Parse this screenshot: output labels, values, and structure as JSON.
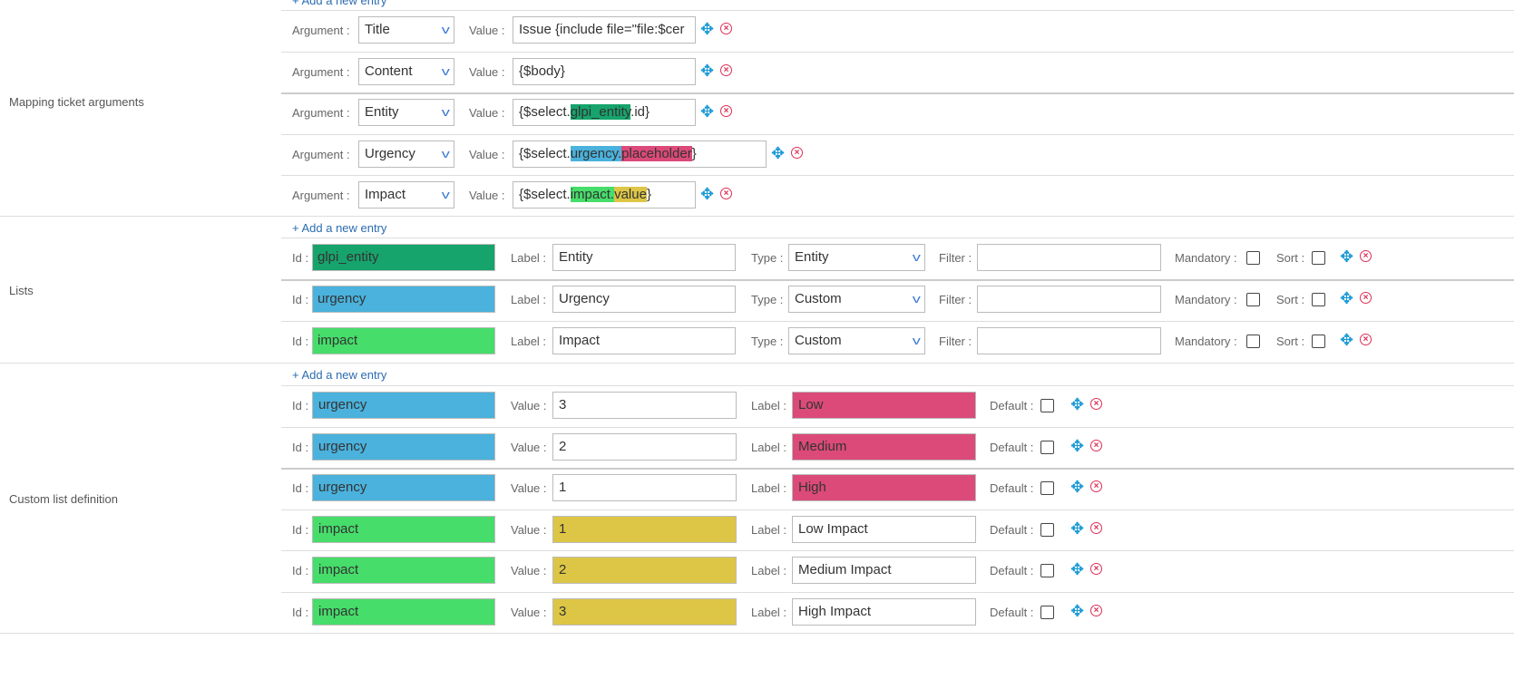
{
  "colors": {
    "dark_green": "#16a46c",
    "blue": "#4ab2dc",
    "pink": "#dc4a7a",
    "green": "#46dd6a",
    "yellow": "#ddc646"
  },
  "labels": {
    "argument": "Argument :",
    "value": "Value :",
    "id": "Id :",
    "label": "Label :",
    "type": "Type :",
    "filter": "Filter :",
    "mandatory": "Mandatory :",
    "sort": "Sort :",
    "default": "Default :",
    "add_entry": "+ Add a new entry"
  },
  "icons": {
    "move": "move-arrows-icon",
    "delete": "delete-circle-x-icon",
    "dropdown": "chevron-down-icon"
  },
  "mapping": {
    "title": "Mapping ticket arguments",
    "rows": [
      {
        "argument": "Title",
        "value": [
          {
            "text": "Issue {include file=\"file:$cer",
            "color": ""
          }
        ]
      },
      {
        "argument": "Content",
        "value": [
          {
            "text": "{$body}",
            "color": ""
          }
        ]
      },
      {
        "argument": "Entity",
        "value": [
          {
            "text": "{$select.",
            "color": ""
          },
          {
            "text": "glpi_entity",
            "color": "dark_green"
          },
          {
            "text": ".id}",
            "color": ""
          }
        ]
      },
      {
        "argument": "Urgency",
        "value": [
          {
            "text": "{$select.",
            "color": ""
          },
          {
            "text": "urgency.",
            "color": "blue"
          },
          {
            "text": "placeholder",
            "color": "pink"
          },
          {
            "text": "}",
            "color": ""
          }
        ]
      },
      {
        "argument": "Impact",
        "value": [
          {
            "text": "{$select.",
            "color": ""
          },
          {
            "text": "impact.",
            "color": "green"
          },
          {
            "text": "value",
            "color": "yellow"
          },
          {
            "text": "}",
            "color": ""
          }
        ]
      }
    ]
  },
  "lists": {
    "title": "Lists",
    "rows": [
      {
        "id": "glpi_entity",
        "id_color": "dark_green",
        "label": "Entity",
        "type": "Entity",
        "filter": "",
        "mandatory": false,
        "sort": false
      },
      {
        "id": "urgency",
        "id_color": "blue",
        "label": "Urgency",
        "type": "Custom",
        "filter": "",
        "mandatory": false,
        "sort": false
      },
      {
        "id": "impact",
        "id_color": "green",
        "label": "Impact",
        "type": "Custom",
        "filter": "",
        "mandatory": false,
        "sort": false
      }
    ]
  },
  "custom": {
    "title": "Custom list definition",
    "rows": [
      {
        "id": "urgency",
        "id_color": "blue",
        "value": "3",
        "value_color": "",
        "label": "Low",
        "label_color": "pink",
        "default": false
      },
      {
        "id": "urgency",
        "id_color": "blue",
        "value": "2",
        "value_color": "",
        "label": "Medium",
        "label_color": "pink",
        "default": false
      },
      {
        "id": "urgency",
        "id_color": "blue",
        "value": "1",
        "value_color": "",
        "label": "High",
        "label_color": "pink",
        "default": false
      },
      {
        "id": "impact",
        "id_color": "green",
        "value": "1",
        "value_color": "yellow",
        "label": "Low Impact",
        "label_color": "",
        "default": false
      },
      {
        "id": "impact",
        "id_color": "green",
        "value": "2",
        "value_color": "yellow",
        "label": "Medium Impact",
        "label_color": "",
        "default": false
      },
      {
        "id": "impact",
        "id_color": "green",
        "value": "3",
        "value_color": "yellow",
        "label": "High Impact",
        "label_color": "",
        "default": false
      }
    ]
  }
}
